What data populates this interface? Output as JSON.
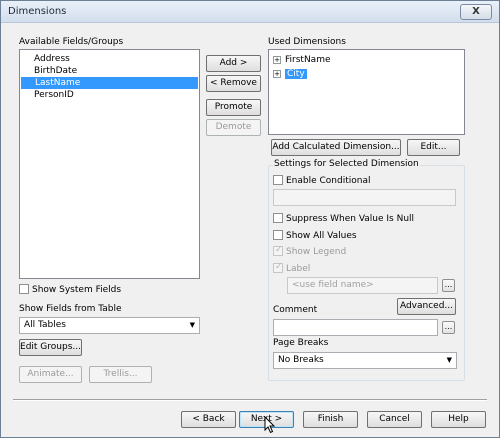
{
  "window": {
    "title": "Dimensions",
    "close_label": "X"
  },
  "available": {
    "label": "Available Fields/Groups",
    "items": [
      "Address",
      "BirthDate",
      "LastName",
      "PersonID"
    ],
    "selected": "LastName"
  },
  "transfer": {
    "add": "Add >",
    "remove": "< Remove",
    "promote": "Promote",
    "demote": "Demote"
  },
  "used": {
    "label": "Used Dimensions",
    "items": [
      {
        "label": "FirstName",
        "expander": "+"
      },
      {
        "label": "City",
        "expander": "+"
      }
    ],
    "selected": "City"
  },
  "used_buttons": {
    "add_calculated": "Add Calculated Dimension...",
    "edit": "Edit..."
  },
  "settings": {
    "label": "Settings for Selected Dimension",
    "enable_conditional": "Enable Conditional",
    "suppress_null": "Suppress When Value Is Null",
    "show_all_values": "Show All Values",
    "show_legend": "Show Legend",
    "label_option": "Label",
    "field_placeholder": "<use field name>",
    "advanced": "Advanced...",
    "comment_label": "Comment",
    "page_breaks_label": "Page Breaks",
    "page_breaks_value": "No Breaks",
    "dots": "..."
  },
  "left_options": {
    "show_system_fields": "Show System Fields",
    "show_fields_from_table": "Show Fields from Table",
    "table_value": "All Tables",
    "edit_groups": "Edit Groups...",
    "animate": "Animate...",
    "trellis": "Trellis..."
  },
  "footer": {
    "back": "< Back",
    "next": "Next >",
    "finish": "Finish",
    "cancel": "Cancel",
    "help": "Help"
  }
}
